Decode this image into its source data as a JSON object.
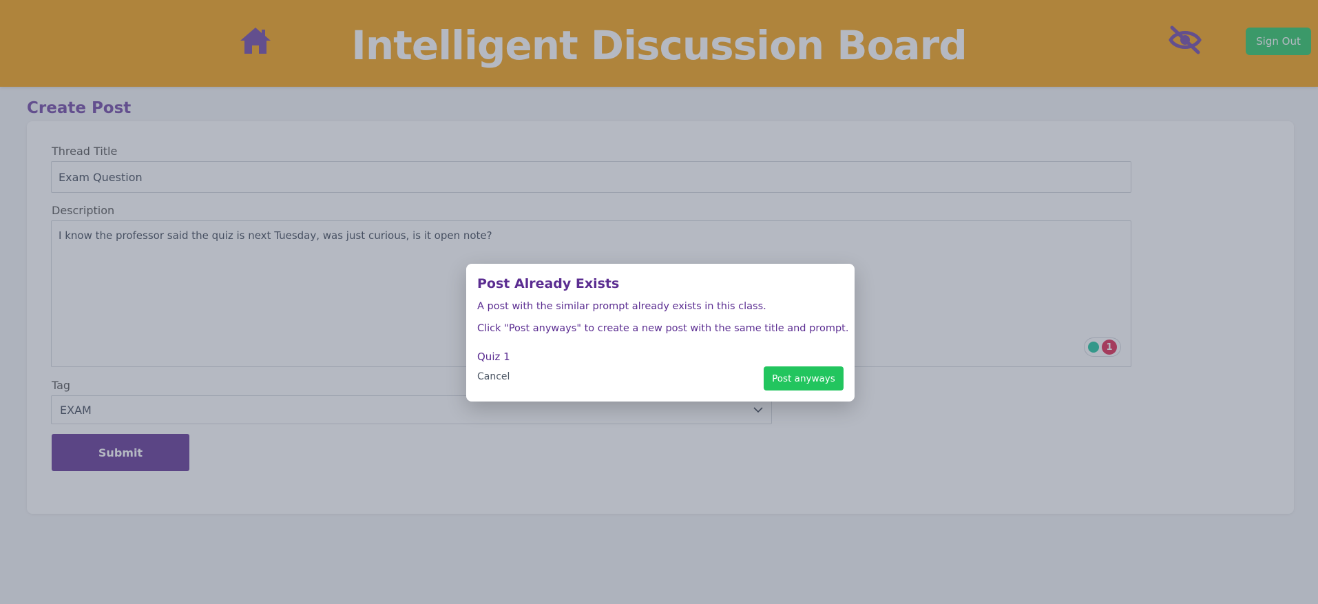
{
  "header": {
    "title": "Intelligent Discussion Board",
    "signout_label": "Sign Out"
  },
  "form": {
    "page_title": "Create Post",
    "thread_title_label": "Thread Title",
    "thread_title_value": "Exam Question",
    "description_label": "Description",
    "description_value": "I know the professor said the quiz is next Tuesday, was just curious, is it open note?",
    "grammar_issue_count": "1",
    "tag_label": "Tag",
    "tag_value": "EXAM",
    "submit_label": "Submit"
  },
  "modal": {
    "title": "Post Already Exists",
    "line1": "A post with the similar prompt already exists in this class.",
    "line2": "Click \"Post anyways\" to create a new post with the same title and prompt.",
    "existing_post": "Quiz 1",
    "cancel_label": "Cancel",
    "post_anyways_label": "Post anyways"
  },
  "colors": {
    "header_bg": "#f59e0b",
    "brand_purple": "#5b2d91",
    "success_green": "#22c55e"
  },
  "icons": {
    "home": "home-icon",
    "hide": "eye-slash-icon",
    "dropdown": "chevron-down-icon"
  }
}
